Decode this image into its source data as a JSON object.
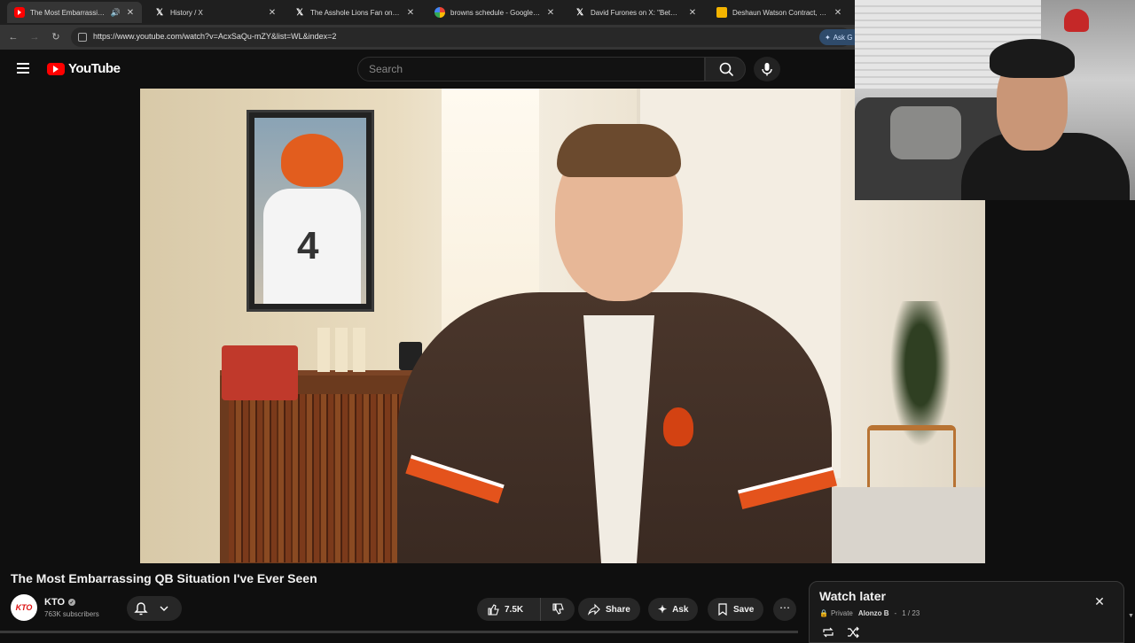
{
  "browser": {
    "tabs": [
      {
        "title": "The Most Embarrassing QB Situ",
        "favicon": "youtube-icon",
        "active": true,
        "audio": true
      },
      {
        "title": "History / X",
        "favicon": "x-icon"
      },
      {
        "title": "The Asshole Lions Fan on X: \"h",
        "favicon": "x-icon"
      },
      {
        "title": "browns schedule - Google Sear",
        "favicon": "google-icon"
      },
      {
        "title": "David Furones on X: \"BetMGM",
        "favicon": "x-icon"
      },
      {
        "title": "Deshaun Watson Contract, Sala",
        "favicon": "doc-icon"
      }
    ],
    "url": "https://www.youtube.com/watch?v=AcxSaQu-mZY&list=WL&index=2",
    "ask_chip": "Ask G"
  },
  "header": {
    "logo_text": "YouTube",
    "search_placeholder": "Search"
  },
  "video": {
    "title": "The Most Embarrassing QB Situation I've Ever Seen",
    "poster_number": "4"
  },
  "channel": {
    "name": "KTO",
    "subscribers": "763K subscribers",
    "avatar_text": "KTO"
  },
  "actions": {
    "likes": "7.5K",
    "share": "Share",
    "ask": "Ask",
    "save": "Save"
  },
  "playlist": {
    "title": "Watch later",
    "privacy": "Private",
    "owner": "Alonzo B",
    "position": "1 / 23"
  },
  "colors": {
    "background": "#0f0f0f",
    "yt_red": "#ff0000",
    "chip": "#272727",
    "text": "#f1f1f1"
  }
}
